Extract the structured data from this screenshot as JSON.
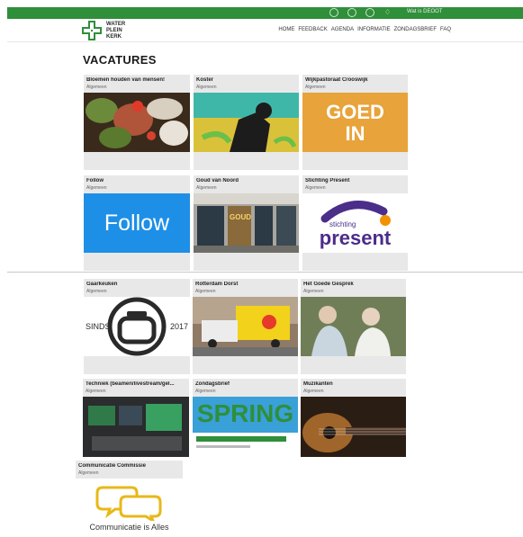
{
  "topbar": {
    "user_label": "Wat is DEOOT",
    "icons": [
      "facebook-icon",
      "youtube-icon",
      "search-icon",
      "bell-icon"
    ]
  },
  "logo": {
    "name": "WATER\nPLEIN\nKERK"
  },
  "nav": {
    "items": [
      "HOME",
      "FEEDBACK",
      "AGENDA",
      "INFORMATIE",
      "ZONDAGSBRIEF",
      "FAQ"
    ]
  },
  "page": {
    "title": "VACATURES"
  },
  "cards": [
    {
      "title": "Bloemen houden van mensen!",
      "category": "Algemeen"
    },
    {
      "title": "Koster",
      "category": "Algemeen"
    },
    {
      "title": "Wijkpastoraat Crooswijk",
      "category": "Algemeen",
      "image_text": "GOED\nIN"
    },
    {
      "title": "Follow",
      "category": "Algemeen",
      "image_text": "Follow"
    },
    {
      "title": "Goud van Noord",
      "category": "Algemeen",
      "image_text": "GOUD"
    },
    {
      "title": "Stichting Present",
      "category": "Algemeen",
      "image_text_small": "stichting",
      "image_text_big": "present"
    },
    {
      "title": "Gaarkeuken",
      "category": "Algemeen",
      "image_text_left": "SINDS",
      "image_text_right": "2017"
    },
    {
      "title": "Rotterdam Dorst",
      "category": "Algemeen"
    },
    {
      "title": "Het Goede Gesprek",
      "category": "Algemeen"
    },
    {
      "title": "Techniek (beamen/livestream/gel...",
      "category": "Algemeen"
    },
    {
      "title": "Zondagsbrief",
      "category": "Algemeen",
      "image_text": "SPRING"
    },
    {
      "title": "Muzikanten",
      "category": "Algemeen"
    },
    {
      "title": "Communicatie Commissie",
      "category": "Algemeen",
      "image_text": "Communicatie is Alles"
    }
  ],
  "colors": {
    "brand_green": "#2f8f3a",
    "card_bg": "#e8e8e8",
    "follow_blue": "#1e8fe6",
    "present_purple": "#4b2d8a",
    "present_orange": "#f39200"
  }
}
